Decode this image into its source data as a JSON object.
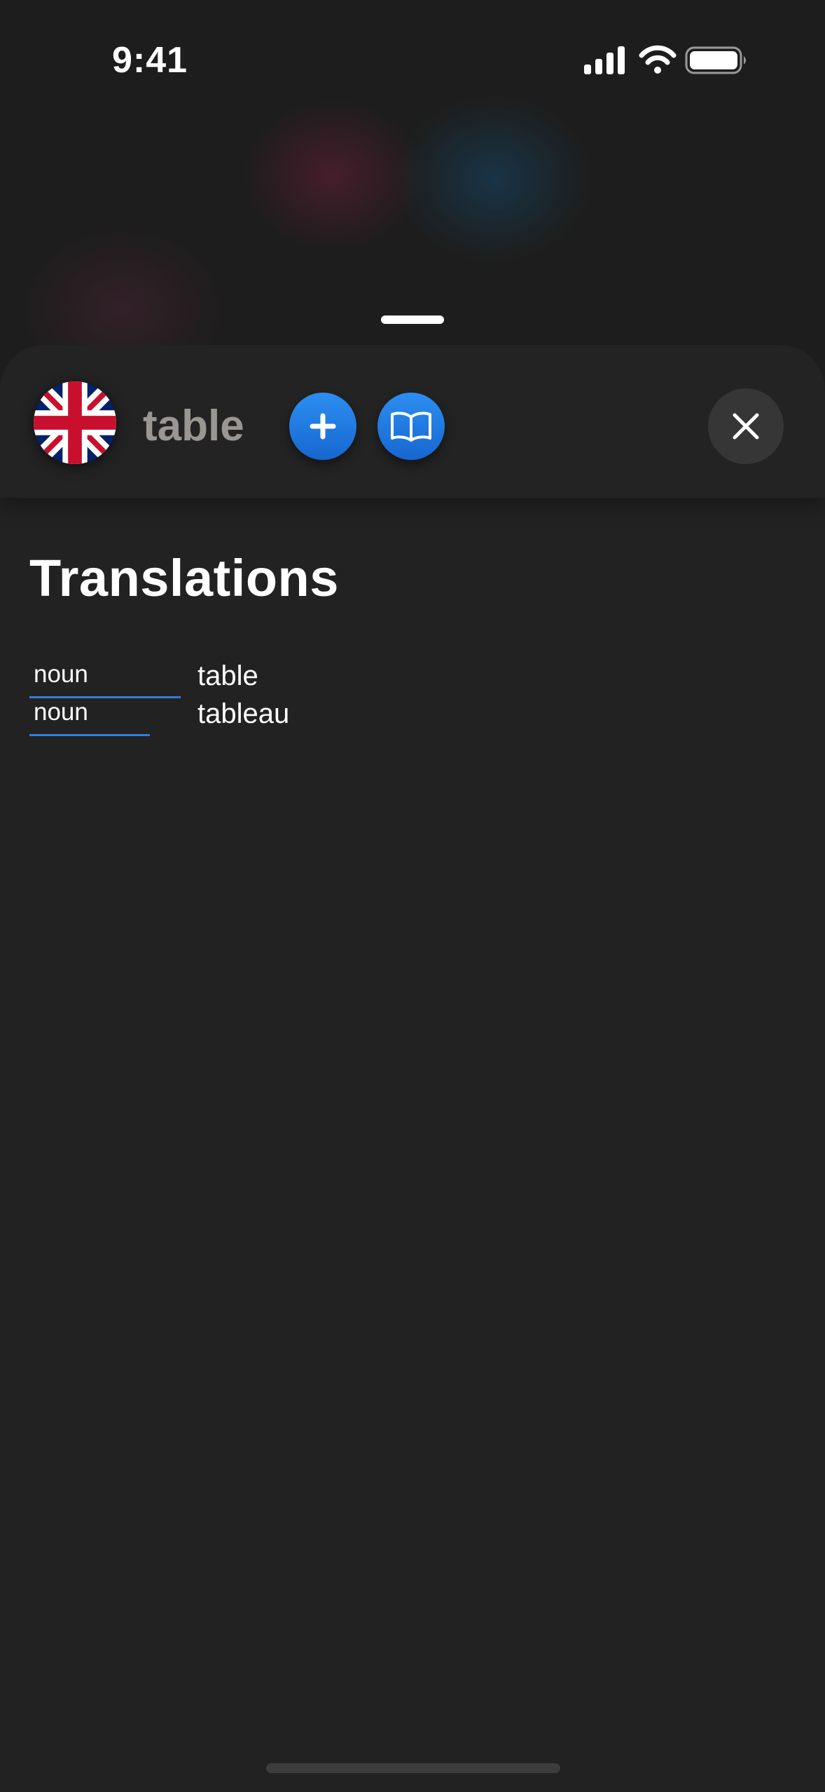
{
  "status_bar": {
    "time": "9:41",
    "icons": [
      "cellular-signal-icon",
      "wifi-icon",
      "battery-icon"
    ]
  },
  "header": {
    "language_flag": "united-kingdom-flag-icon",
    "word": "table",
    "buttons": [
      {
        "icon": "plus-icon",
        "color": "#1f7ae6"
      },
      {
        "icon": "open-book-icon",
        "color": "#1f7ae6"
      },
      {
        "icon": "close-icon",
        "color": "#363636"
      }
    ]
  },
  "translations": {
    "title": "Translations",
    "items": [
      {
        "part_of_speech": "noun",
        "word": "table"
      },
      {
        "part_of_speech": "noun",
        "word": "tableau"
      }
    ]
  },
  "colors": {
    "accent": "#1f7ae6",
    "background": "#222222",
    "word_text": "#9a9793"
  }
}
